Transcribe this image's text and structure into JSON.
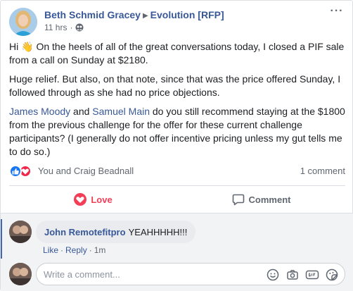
{
  "post": {
    "author": "Beth Schmid Gracey",
    "group": "Evolution [RFP]",
    "time": "11 hrs",
    "dot": "·",
    "more_label": "···",
    "paragraphs": {
      "p1_start": "Hi ",
      "p1_rest": " On the heels of all of the great conversations today, I closed a PIF sale from a call on Sunday at $2180.",
      "p2": "Huge relief. But also, on that note, since that was the price offered Sunday, I followed through as she had no price objections.",
      "p3_mention1": "James Moody",
      "p3_and": " and ",
      "p3_mention2": "Samuel Main",
      "p3_rest": " do you still recommend staying at the $1800 from the previous challenge for the offer for these current challenge participants? (I generally do not offer incentive pricing unless my gut tells me to do so.)"
    },
    "emoji_wave": "👋"
  },
  "reactions": {
    "reactors": "You and Craig Beadnall",
    "comment_count": "1 comment"
  },
  "actions": {
    "love_label": "Love",
    "comment_label": "Comment"
  },
  "comment": {
    "author": "John Remotefitpro",
    "text": "YEAHHHHH!!!",
    "like_label": "Like",
    "reply_label": "Reply",
    "sep": "·",
    "time": "1m"
  },
  "composer": {
    "placeholder": "Write a comment..."
  },
  "colors": {
    "link": "#385898",
    "love": "#f33e58",
    "like_blue": "#1877f2"
  }
}
